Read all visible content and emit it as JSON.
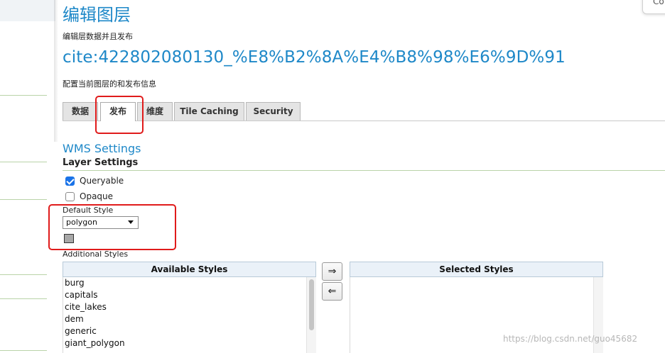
{
  "page": {
    "title": "编辑图层",
    "description": "编辑层数据并且发布",
    "layer_name": "cite:422802080130_%E8%B2%8A%E4%B8%98%E6%9D%91",
    "layer_description": "配置当前图层的和发布信息"
  },
  "popup": {
    "label": "Co"
  },
  "tabs": [
    {
      "label": "数据",
      "active": false
    },
    {
      "label": "发布",
      "active": true
    },
    {
      "label": "维度",
      "active": false
    },
    {
      "label": "Tile Caching",
      "active": false
    },
    {
      "label": "Security",
      "active": false
    }
  ],
  "wms": {
    "section_title": "WMS Settings",
    "layer_settings_title": "Layer Settings",
    "queryable": {
      "label": "Queryable",
      "checked": true
    },
    "opaque": {
      "label": "Opaque",
      "checked": false
    },
    "default_style": {
      "label": "Default Style",
      "value": "polygon"
    },
    "additional_styles_label": "Additional Styles",
    "available_styles": {
      "header": "Available Styles",
      "items": [
        "burg",
        "capitals",
        "cite_lakes",
        "dem",
        "generic",
        "giant_polygon"
      ]
    },
    "selected_styles": {
      "header": "Selected Styles",
      "items": []
    },
    "move_right_glyph": "⇒",
    "move_left_glyph": "⇐"
  },
  "watermark": "https://blog.csdn.net/guo45682",
  "colors": {
    "accent_blue": "#1e88c8",
    "highlight_red": "#e01b1b",
    "section_rule": "#b9d3a8"
  }
}
